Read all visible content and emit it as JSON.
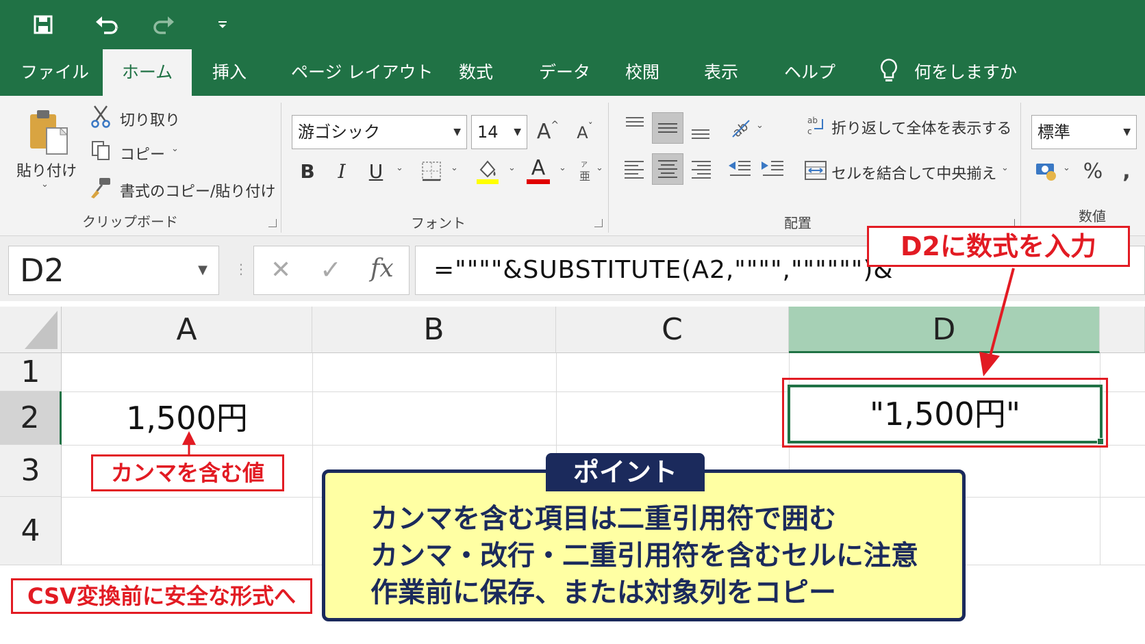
{
  "colors": {
    "excel_green": "#207245",
    "annotation_red": "#e21b23",
    "point_yellow": "#ffffa3",
    "point_navy": "#1b2a5c"
  },
  "quick_access": {
    "icons": [
      "save-icon",
      "undo-icon",
      "redo-icon",
      "customize-qat-icon"
    ]
  },
  "tabs": [
    "ファイル",
    "ホーム",
    "挿入",
    "ページ レイアウト",
    "数式",
    "データ",
    "校閲",
    "表示",
    "ヘルプ"
  ],
  "tell_me": "何をしますか",
  "ribbon": {
    "clipboard": {
      "paste": "貼り付け",
      "cut": "切り取り",
      "copy": "コピー",
      "format_painter": "書式のコピー/貼り付け",
      "group_label": "クリップボード"
    },
    "font": {
      "font_name": "游ゴシック",
      "font_size": "14",
      "bold": "B",
      "italic": "I",
      "underline": "U",
      "font_color_letter": "A",
      "grow": "A",
      "shrink": "A",
      "group_label": "フォント"
    },
    "alignment": {
      "wrap_text": "折り返して全体を表示する",
      "merge_center": "セルを結合して中央揃え",
      "group_label": "配置"
    },
    "number": {
      "format": "標準",
      "percent": "%",
      "comma": ",",
      "group_label": "数値"
    }
  },
  "formula_bar": {
    "name_box": "D2",
    "fx": "fx",
    "cancel": "✕",
    "enter": "✓",
    "formula": "=\"\"\"\"&SUBSTITUTE(A2,\"\"\"\",\"\"\"\"\"\")&\"\"\"\""
  },
  "sheet": {
    "columns": [
      "A",
      "B",
      "C",
      "D"
    ],
    "rows": [
      "1",
      "2",
      "3",
      "4"
    ],
    "cells": {
      "A2": "1,500円",
      "D2": "\"1,500円\""
    }
  },
  "annotations": {
    "d2_callout": "D2に数式を入力",
    "a2_callout": "カンマを含む値",
    "bottom_note": "CSV変換前に安全な形式へ",
    "point_title": "ポイント",
    "point_lines": [
      "カンマを含む項目は二重引用符で囲む",
      "カンマ・改行・二重引用符を含むセルに注意",
      "作業前に保存、または対象列をコピー"
    ]
  }
}
